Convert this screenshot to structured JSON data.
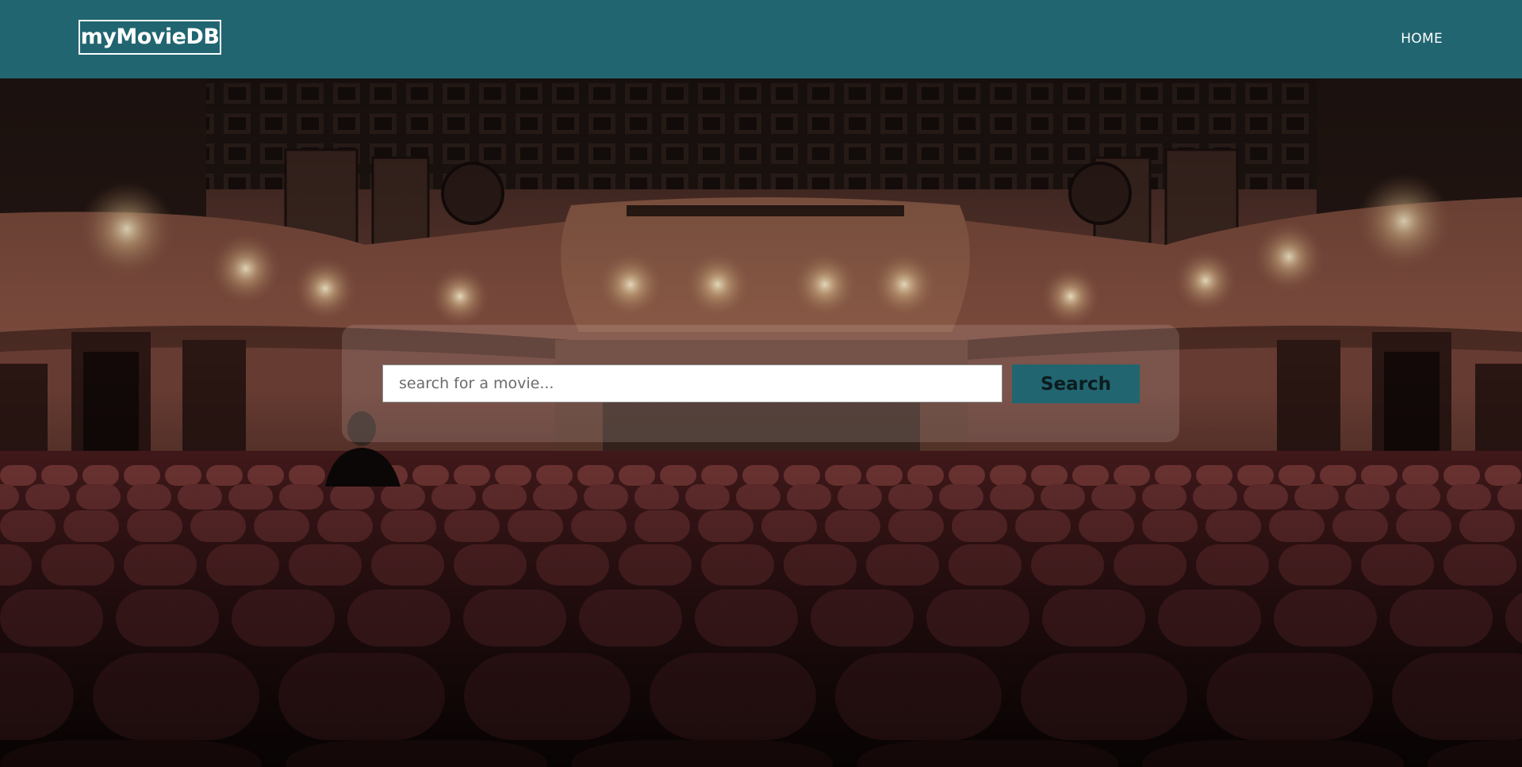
{
  "app": {
    "logo_text": "myMovieDB"
  },
  "nav": {
    "home_label": "HOME"
  },
  "search": {
    "placeholder": "search for a movie...",
    "value": "",
    "button_label": "Search"
  },
  "colors": {
    "navbar": "#216570",
    "button": "#216570",
    "seats": "#5a1f22"
  },
  "hero": {
    "image_subject": "empty-theater-auditorium"
  }
}
